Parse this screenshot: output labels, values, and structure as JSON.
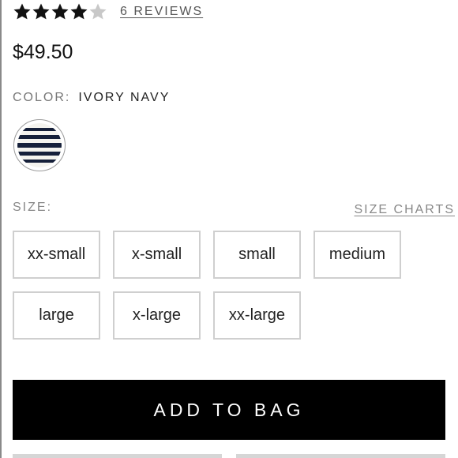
{
  "rating": {
    "stars_filled": 4,
    "stars_total": 5,
    "reviews_label": "6 REVIEWS"
  },
  "product": {
    "price": "$49.50",
    "color_label": "COLOR:",
    "color_value": "IVORY NAVY"
  },
  "size": {
    "label": "SIZE:",
    "charts_label": "SIZE CHARTS",
    "options": [
      "xx-small",
      "x-small",
      "small",
      "medium",
      "large",
      "x-large",
      "xx-large"
    ]
  },
  "actions": {
    "add_to_bag": "ADD TO BAG"
  },
  "colors": {
    "star_filled": "#111111",
    "star_empty": "#c8c8c8",
    "button_bg": "#000000",
    "navy": "#16203a",
    "ivory": "#f4f3ee"
  },
  "icons": {
    "star": "star-icon",
    "swatch": "striped-swatch"
  }
}
